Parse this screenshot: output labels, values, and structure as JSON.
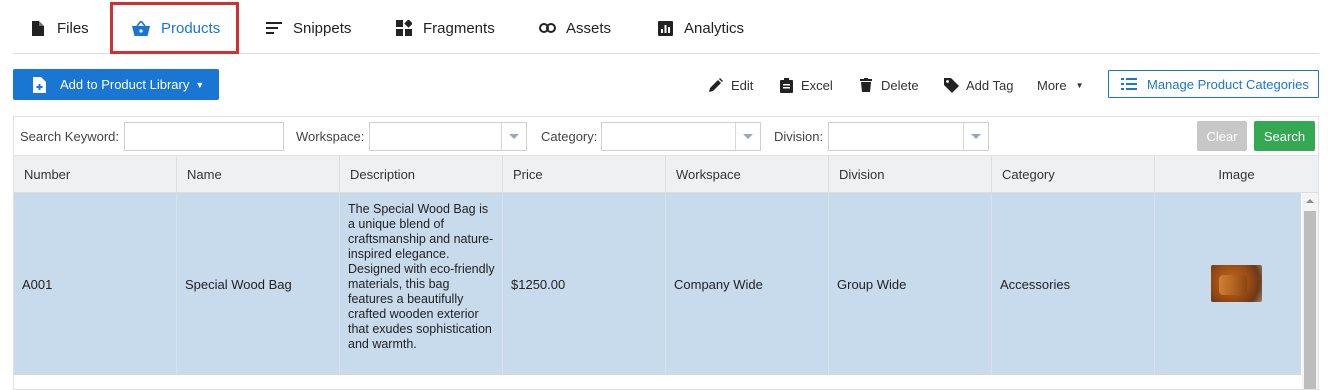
{
  "tabs": [
    {
      "label": "Files",
      "icon": "file-icon"
    },
    {
      "label": "Products",
      "icon": "basket-icon",
      "active": true
    },
    {
      "label": "Snippets",
      "icon": "lines-icon"
    },
    {
      "label": "Fragments",
      "icon": "puzzle-icon"
    },
    {
      "label": "Assets",
      "icon": "link-icon"
    },
    {
      "label": "Analytics",
      "icon": "chart-icon"
    }
  ],
  "toolbar": {
    "add_label": "Add to Product Library",
    "edit_label": "Edit",
    "excel_label": "Excel",
    "delete_label": "Delete",
    "addtag_label": "Add Tag",
    "more_label": "More",
    "manage_label": "Manage Product Categories"
  },
  "filters": {
    "keyword_label": "Search Keyword:",
    "keyword_value": "",
    "workspace_label": "Workspace:",
    "workspace_value": "",
    "category_label": "Category:",
    "category_value": "",
    "division_label": "Division:",
    "division_value": "",
    "clear_label": "Clear",
    "search_label": "Search"
  },
  "table": {
    "columns": [
      "Number",
      "Name",
      "Description",
      "Price",
      "Workspace",
      "Division",
      "Category",
      "Image"
    ],
    "rows": [
      {
        "number": "A001",
        "name": "Special Wood Bag",
        "description": "The Special Wood Bag is a unique blend of craftsmanship and nature-inspired elegance. Designed with eco-friendly materials, this bag features a beautifully crafted wooden exterior that exudes sophistication and warmth.",
        "price": "$1250.00",
        "workspace": "Company Wide",
        "division": "Group Wide",
        "category": "Accessories",
        "image": "wood-bag-thumbnail"
      }
    ]
  },
  "colors": {
    "primary": "#1976d2",
    "highlight_box": "#d32f2f",
    "selected_row": "#c7dbed",
    "search_green": "#34a853",
    "clear_gray": "#c7c7c7"
  }
}
